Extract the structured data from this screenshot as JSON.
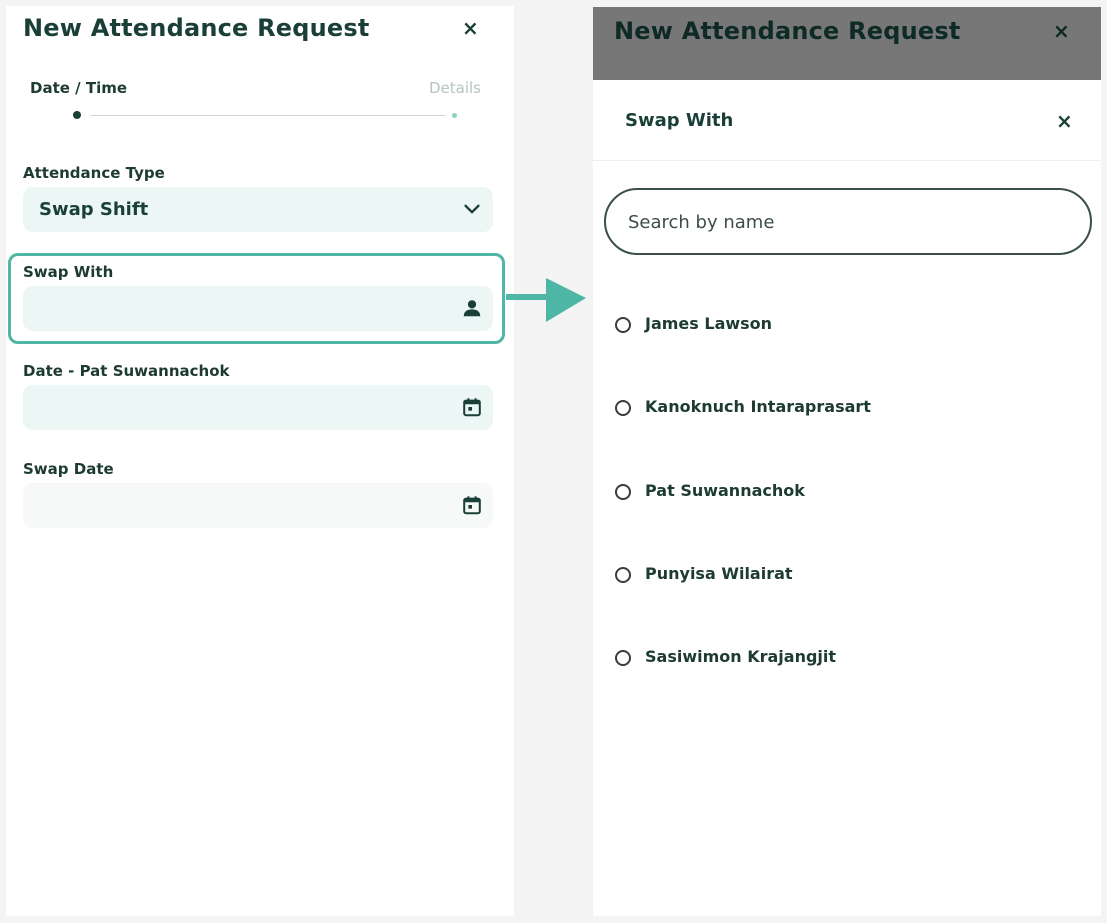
{
  "left": {
    "title": "New Attendance Request",
    "close": "×",
    "steps": [
      "Date / Time",
      "Details"
    ],
    "fields": {
      "attendance_type": {
        "label": "Attendance Type",
        "value": "Swap Shift",
        "icon": "chevron-down-icon"
      },
      "swap_with": {
        "label": "Swap With",
        "value": "",
        "icon": "person-icon"
      },
      "date_person": {
        "label": "Date - Pat Suwannachok",
        "value": "",
        "icon": "calendar-icon"
      },
      "swap_date": {
        "label": "Swap Date",
        "value": "",
        "icon": "calendar-icon"
      }
    }
  },
  "right": {
    "title": "New Attendance Request",
    "close": "×",
    "sheet": {
      "title": "Swap With",
      "close": "×",
      "search_placeholder": "Search by name",
      "options": [
        "James Lawson",
        "Kanoknuch Intaraprasart",
        "Pat Suwannachok",
        "Punyisa Wilairat",
        "Sasiwimon Krajangjit"
      ]
    }
  },
  "colors": {
    "accent": "#4db6a4",
    "primary_text": "#1a3f36",
    "field_bg": "#ebf6f5",
    "overlay": "#777777"
  }
}
